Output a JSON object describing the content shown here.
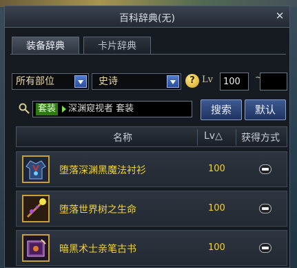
{
  "window": {
    "title": "百科辞典(无)"
  },
  "tabs": [
    {
      "label": "装备辞典",
      "active": true
    },
    {
      "label": "卡片辞典",
      "active": false
    }
  ],
  "filters": {
    "part": "所有部位",
    "rarity": "史诗",
    "help": "?",
    "lv_label": "Lv",
    "lv_min": "100",
    "tilde": "~",
    "lv_max": ""
  },
  "search": {
    "tag": "套装",
    "text": "深渊窥视者  套装",
    "search_label": "搜索",
    "default_label": "默认"
  },
  "table": {
    "headers": {
      "name": "名称",
      "level": "Lv△",
      "method": "获得方式"
    },
    "rows": [
      {
        "name": "堕落深渊黑魔法衬衫",
        "level": "100",
        "icon": "robe-icon"
      },
      {
        "name": "堕落世界树之生命",
        "level": "100",
        "icon": "branch-icon"
      },
      {
        "name": "暗黑术士亲笔古书",
        "level": "100",
        "icon": "book-icon"
      }
    ]
  },
  "colors": {
    "rarity_text": "#f0d23a",
    "button": "#2b4c9b",
    "tag": "#2c7a10"
  }
}
